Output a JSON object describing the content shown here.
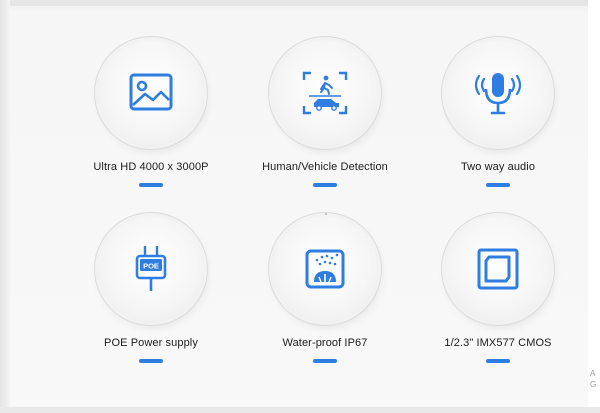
{
  "accent_color": "#2f7de1",
  "features": [
    {
      "label": "Ultra HD 4000 x 3000P",
      "icon": "image-icon"
    },
    {
      "label": "Human/Vehicle Detection",
      "icon": "person-vehicle-detection-icon"
    },
    {
      "label": "Two way audio",
      "icon": "microphone-icon"
    },
    {
      "label": "POE Power supply",
      "icon": "poe-plug-icon"
    },
    {
      "label": "Water-proof IP67",
      "icon": "water-proof-icon"
    },
    {
      "label": "1/2.3\" IMX577 CMOS",
      "icon": "cmos-sensor-icon"
    }
  ],
  "corner": {
    "line1": "A",
    "line2": "G"
  }
}
